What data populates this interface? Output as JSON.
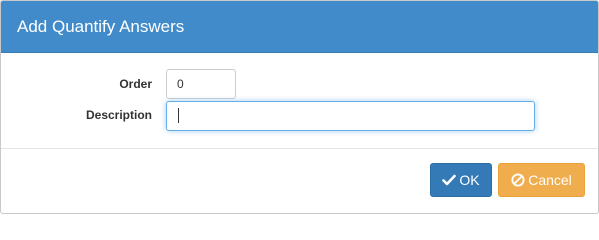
{
  "dialog": {
    "title": "Add Quantify Answers"
  },
  "form": {
    "order_label": "Order",
    "order_value": "0",
    "description_label": "Description",
    "description_value": ""
  },
  "footer": {
    "ok_label": "OK",
    "ok_icon": "check-icon",
    "cancel_label": "Cancel",
    "cancel_icon": "ban-icon"
  },
  "colors": {
    "header": "#428bca",
    "ok_button": "#337ab7",
    "cancel_button": "#f0ad4e"
  }
}
